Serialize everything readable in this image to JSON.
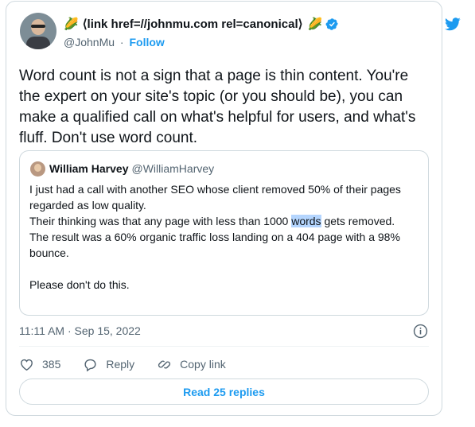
{
  "author": {
    "display_name": "⟨link href=//johnmu.com rel=canonical⟩",
    "emoji": "🌽",
    "handle": "@JohnMu",
    "separator": "·",
    "follow_label": "Follow"
  },
  "tweet": {
    "text": "Word count is not a sign that a page is thin content. You're the expert on your site's topic (or you should be), you can make a qualified call on what's helpful for users, and what's fluff. Don't use word count."
  },
  "quote": {
    "name": "William Harvey",
    "handle": "@WilliamHarvey",
    "line1": "I just had a call with another SEO whose client removed 50% of their pages regarded as low quality.",
    "line2_before": "Their thinking was that any page with less than 1000 ",
    "line2_highlight": "words",
    "line2_after": " gets removed.",
    "line3": "The result was a 60% organic traffic loss landing on a 404 page with a 98% bounce.",
    "line4": "Please don't do this."
  },
  "meta": {
    "timestamp": "11:11 AM · Sep 15, 2022"
  },
  "actions": {
    "like_count": "385",
    "reply_label": "Reply",
    "copy_label": "Copy link"
  },
  "read_replies_label": "Read 25 replies",
  "colors": {
    "accent": "#1d9bf0",
    "text": "#0f1419",
    "secondary": "#536471",
    "border": "#cfd9de",
    "highlight": "#b4d5fe"
  },
  "icons": [
    "twitter-bird-icon",
    "verified-badge-icon",
    "info-icon",
    "heart-icon",
    "reply-bubble-icon",
    "link-icon"
  ]
}
